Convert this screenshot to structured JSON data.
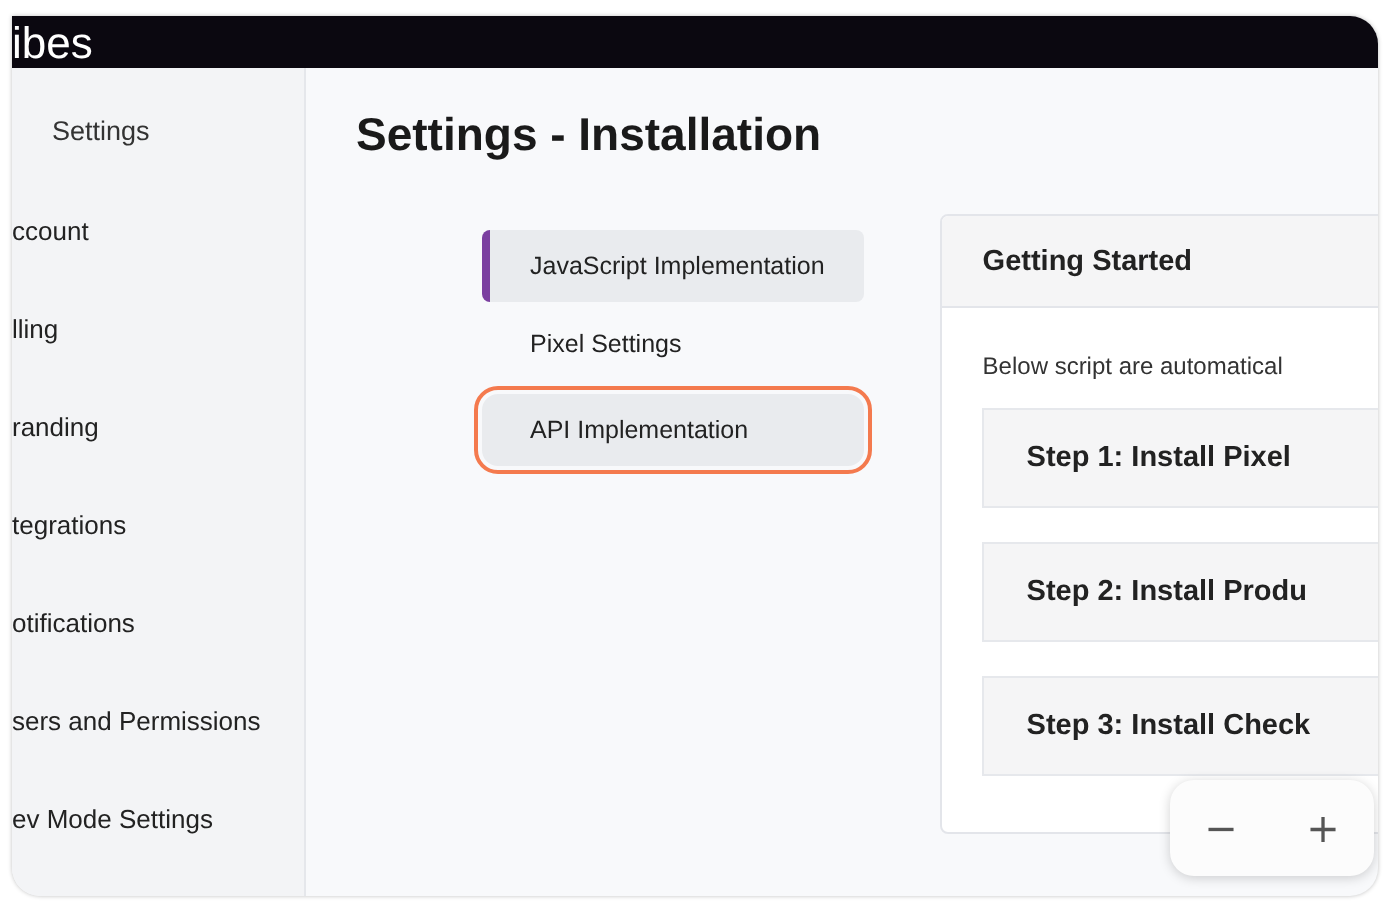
{
  "brand": "ibes",
  "sidebar": {
    "title": "Settings",
    "items": [
      {
        "label": "ccount"
      },
      {
        "label": "lling"
      },
      {
        "label": "randing"
      },
      {
        "label": "tegrations"
      },
      {
        "label": "otifications"
      },
      {
        "label": "sers and Permissions"
      },
      {
        "label": "ev Mode Settings"
      }
    ]
  },
  "page_title": "Settings - Installation",
  "tabs": [
    {
      "label": "JavaScript Implementation",
      "selected": true,
      "focused": false
    },
    {
      "label": "Pixel Settings",
      "selected": false,
      "focused": false
    },
    {
      "label": "API Implementation",
      "selected": false,
      "focused": true
    }
  ],
  "card": {
    "title": "Getting Started",
    "intro": "Below script are automatical",
    "steps": [
      {
        "label": "Step 1: Install Pixel"
      },
      {
        "label": "Step 2: Install Produ"
      },
      {
        "label": "Step 3: Install Check"
      }
    ]
  },
  "zoom": {
    "minus": "−",
    "plus": "+"
  }
}
